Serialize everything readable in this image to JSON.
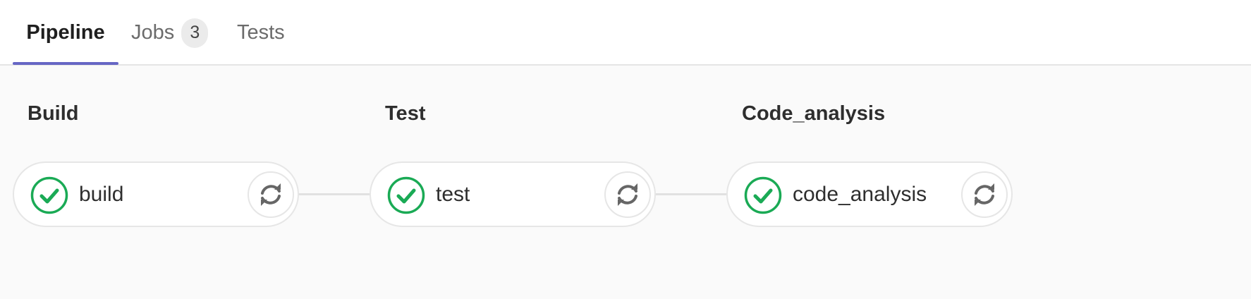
{
  "tabs": {
    "pipeline_label": "Pipeline",
    "jobs_label": "Jobs",
    "jobs_count": "3",
    "tests_label": "Tests",
    "active": "pipeline"
  },
  "colors": {
    "accent_underline": "#6666c4",
    "success": "#1aaa55",
    "retry_icon": "#666666"
  },
  "stages": [
    {
      "title": "Build",
      "job": {
        "name": "build",
        "status": "success",
        "status_icon": "check-circle-icon",
        "action_icon": "retry-icon"
      }
    },
    {
      "title": "Test",
      "job": {
        "name": "test",
        "status": "success",
        "status_icon": "check-circle-icon",
        "action_icon": "retry-icon"
      }
    },
    {
      "title": "Code_analysis",
      "job": {
        "name": "code_analysis",
        "status": "success",
        "status_icon": "check-circle-icon",
        "action_icon": "retry-icon"
      }
    }
  ]
}
